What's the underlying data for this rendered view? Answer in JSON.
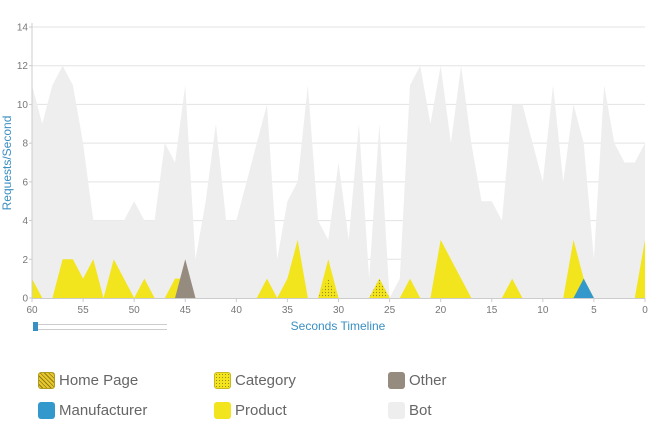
{
  "chart_data": {
    "type": "area",
    "stacked": false,
    "title": "",
    "xlabel": "Seconds Timeline",
    "ylabel": "Requests/Second",
    "xlim": [
      60,
      0
    ],
    "ylim": [
      0,
      14
    ],
    "x_ticks": [
      60,
      55,
      50,
      45,
      40,
      35,
      30,
      25,
      20,
      15,
      10,
      5,
      0
    ],
    "y_ticks": [
      0,
      2,
      4,
      6,
      8,
      10,
      12,
      14
    ],
    "grid": true,
    "legend_position": "bottom",
    "series": [
      {
        "name": "Bot",
        "color": "#eeeeee",
        "points": [
          [
            60,
            11
          ],
          [
            59,
            9
          ],
          [
            58,
            11
          ],
          [
            57,
            12
          ],
          [
            56,
            11
          ],
          [
            55,
            8
          ],
          [
            54,
            4
          ],
          [
            53,
            4
          ],
          [
            52,
            4
          ],
          [
            51,
            4
          ],
          [
            50,
            5
          ],
          [
            49,
            4
          ],
          [
            48,
            4
          ],
          [
            47,
            8
          ],
          [
            46,
            7
          ],
          [
            45,
            11
          ],
          [
            44,
            2
          ],
          [
            43,
            5
          ],
          [
            42,
            9
          ],
          [
            41,
            4
          ],
          [
            40,
            4
          ],
          [
            39,
            6
          ],
          [
            38,
            8
          ],
          [
            37,
            10
          ],
          [
            36,
            2
          ],
          [
            35,
            5
          ],
          [
            34,
            6
          ],
          [
            33,
            11
          ],
          [
            32,
            4
          ],
          [
            31,
            3
          ],
          [
            30,
            7
          ],
          [
            29,
            3
          ],
          [
            28,
            9
          ],
          [
            27,
            1
          ],
          [
            26,
            9
          ],
          [
            25,
            0
          ],
          [
            24,
            1
          ],
          [
            23,
            11
          ],
          [
            22,
            12
          ],
          [
            21,
            9
          ],
          [
            20,
            12
          ],
          [
            19,
            8
          ],
          [
            18,
            12
          ],
          [
            17,
            8
          ],
          [
            16,
            5
          ],
          [
            15,
            5
          ],
          [
            14,
            4
          ],
          [
            13,
            10
          ],
          [
            12,
            10
          ],
          [
            11,
            8
          ],
          [
            10,
            6
          ],
          [
            9,
            11
          ],
          [
            8,
            6
          ],
          [
            7,
            10
          ],
          [
            6,
            8
          ],
          [
            5,
            2
          ],
          [
            4,
            11
          ],
          [
            3,
            8
          ],
          [
            2,
            7
          ],
          [
            1,
            7
          ],
          [
            0,
            8
          ]
        ]
      },
      {
        "name": "Product",
        "color": "#f2e41d",
        "points": [
          [
            60,
            1
          ],
          [
            59,
            0
          ],
          [
            58,
            0
          ],
          [
            57,
            2
          ],
          [
            56,
            2
          ],
          [
            55,
            1
          ],
          [
            54,
            2
          ],
          [
            53,
            0
          ],
          [
            52,
            2
          ],
          [
            51,
            1
          ],
          [
            50,
            0
          ],
          [
            49,
            1
          ],
          [
            48,
            0
          ],
          [
            47,
            0
          ],
          [
            46,
            1
          ],
          [
            45,
            1
          ],
          [
            44,
            0
          ],
          [
            43,
            0
          ],
          [
            42,
            0
          ],
          [
            41,
            0
          ],
          [
            40,
            0
          ],
          [
            39,
            0
          ],
          [
            38,
            0
          ],
          [
            37,
            1
          ],
          [
            36,
            0
          ],
          [
            35,
            1
          ],
          [
            34,
            3
          ],
          [
            33,
            0
          ],
          [
            32,
            0
          ],
          [
            31,
            2
          ],
          [
            30,
            0
          ],
          [
            29,
            0
          ],
          [
            28,
            0
          ],
          [
            27,
            0
          ],
          [
            26,
            1
          ],
          [
            25,
            0
          ],
          [
            24,
            0
          ],
          [
            23,
            1
          ],
          [
            22,
            0
          ],
          [
            21,
            0
          ],
          [
            20,
            3
          ],
          [
            19,
            2
          ],
          [
            18,
            1
          ],
          [
            17,
            0
          ],
          [
            16,
            0
          ],
          [
            15,
            0
          ],
          [
            14,
            0
          ],
          [
            13,
            1
          ],
          [
            12,
            0
          ],
          [
            11,
            0
          ],
          [
            10,
            0
          ],
          [
            9,
            0
          ],
          [
            8,
            0
          ],
          [
            7,
            3
          ],
          [
            6,
            1
          ],
          [
            5,
            0
          ],
          [
            4,
            0
          ],
          [
            3,
            0
          ],
          [
            2,
            0
          ],
          [
            1,
            0
          ],
          [
            0,
            3
          ]
        ]
      },
      {
        "name": "Category",
        "color": "#f2e41d",
        "points": [
          [
            32,
            0
          ],
          [
            31,
            1
          ],
          [
            30,
            0
          ],
          [
            27,
            0
          ],
          [
            26,
            1
          ],
          [
            25,
            0
          ]
        ]
      },
      {
        "name": "Other",
        "color": "#968b7f",
        "points": [
          [
            46,
            0
          ],
          [
            45,
            2
          ],
          [
            44,
            0
          ]
        ]
      },
      {
        "name": "Manufacturer",
        "color": "#3399cc",
        "points": [
          [
            7,
            0
          ],
          [
            6,
            1
          ],
          [
            5,
            0
          ]
        ]
      }
    ]
  },
  "legend": [
    {
      "label": "Home Page",
      "color": "#e9c929",
      "pattern": "hatched"
    },
    {
      "label": "Category",
      "color": "#f2e41d",
      "pattern": "dotted"
    },
    {
      "label": "Other",
      "color": "#968b7f",
      "pattern": "solid"
    },
    {
      "label": "Manufacturer",
      "color": "#3399cc",
      "pattern": "solid"
    },
    {
      "label": "Product",
      "color": "#f2e41d",
      "pattern": "solid"
    },
    {
      "label": "Bot",
      "color": "#eeeeee",
      "pattern": "solid"
    }
  ]
}
